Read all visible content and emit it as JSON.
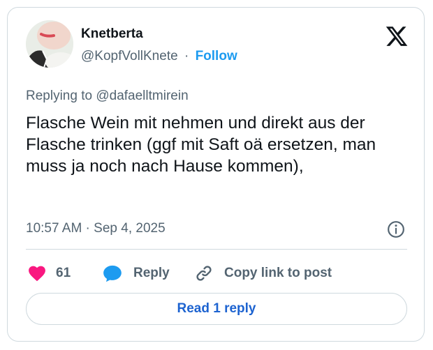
{
  "author": {
    "display_name": "Knetberta",
    "handle": "@KopfVollKnete",
    "separator": "·",
    "follow_label": "Follow"
  },
  "reply_context": {
    "prefix": "Replying to ",
    "mention": "@dafaelltmirein"
  },
  "tweet": {
    "text": "Flasche Wein mit nehmen und direkt aus der Flasche trinken (ggf mit Saft oä ersetzen, man muss ja noch nach Hause kommen),",
    "timestamp": "10:57 AM · Sep 4, 2025"
  },
  "actions": {
    "like_count": "61",
    "reply_label": "Reply",
    "copy_label": "Copy link to post"
  },
  "read_replies_label": "Read 1 reply",
  "icons": {
    "brand": "x-logo-icon",
    "like": "heart-icon",
    "reply": "speech-bubble-icon",
    "copy": "link-icon",
    "info": "info-icon"
  },
  "colors": {
    "accent": "#1d9bf0",
    "like": "#f91880",
    "text_primary": "#0f1419",
    "text_secondary": "#536471",
    "border": "#cfd9de"
  }
}
